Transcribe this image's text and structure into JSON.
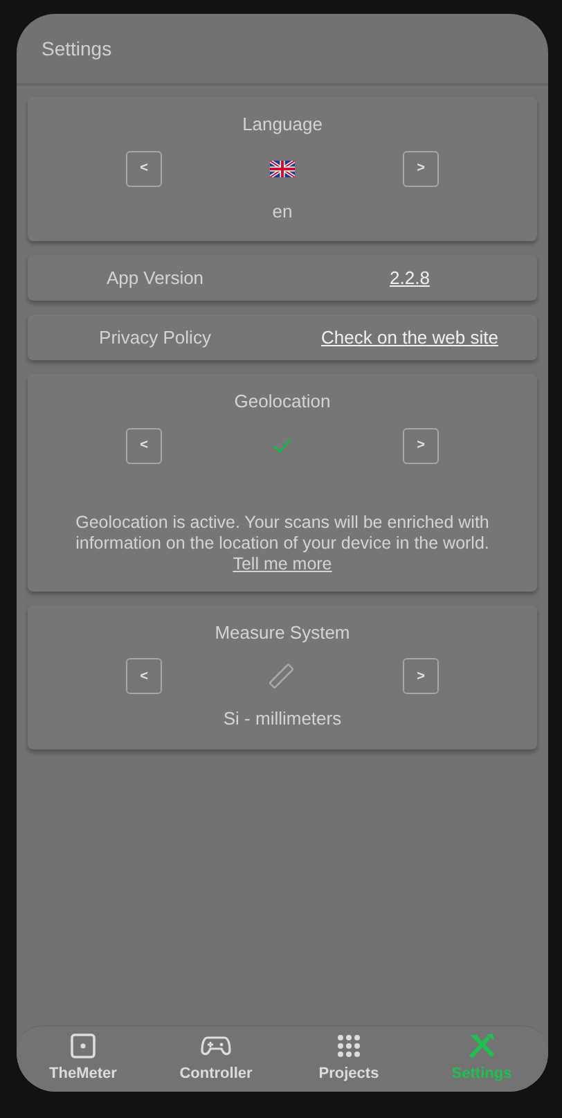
{
  "header": {
    "title": "Settings"
  },
  "cards": [
    {
      "kind": "selector",
      "title": "Language",
      "prev": "<",
      "next": ">",
      "value": "en"
    },
    {
      "kind": "row",
      "label": "App Version",
      "link": "2.2.8"
    },
    {
      "kind": "row",
      "label": "Privacy Policy",
      "link": "Check on the web site"
    },
    {
      "kind": "selector",
      "title": "Geolocation",
      "prev": "<",
      "next": ">",
      "description": "Geolocation is active. Your scans will be enriched with information on the location of your device in the world.",
      "link": "Tell me more"
    },
    {
      "kind": "selector",
      "title": "Measure System",
      "prev": "<",
      "next": ">",
      "value": "Si - millimeters"
    }
  ],
  "nav": [
    {
      "label": "TheMeter",
      "selected": false
    },
    {
      "label": "Controller",
      "selected": false
    },
    {
      "label": "Projects",
      "selected": false
    },
    {
      "label": "Settings",
      "selected": true
    }
  ]
}
